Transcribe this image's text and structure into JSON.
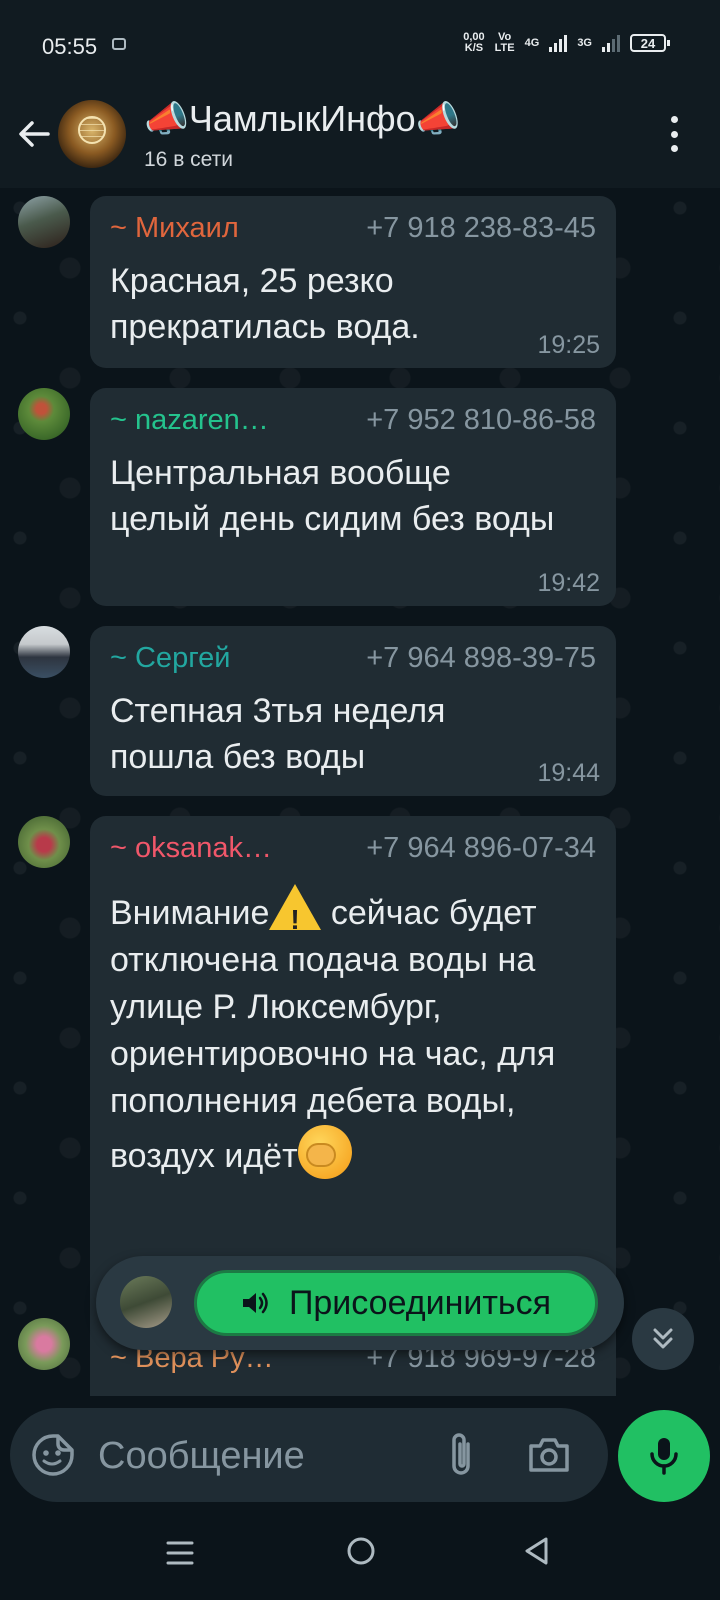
{
  "status_bar": {
    "time": "05:55",
    "speed_value": "0,00",
    "speed_unit": "K/S",
    "volte_top": "Vo",
    "volte_bottom": "LTE",
    "net_1": "4G",
    "net_2": "3G",
    "battery": "24"
  },
  "header": {
    "group_name": "📣ЧамлыкИнфо📣",
    "online_status": "16 в сети"
  },
  "messages": [
    {
      "sender": "~ Михаил",
      "sender_color": "#e0663d",
      "phone": "+7 918 238-83-45",
      "text": "Красная, 25 резко прекратилась вода.",
      "time": "19:25"
    },
    {
      "sender": "~ nazaren…",
      "sender_color": "#24c38d",
      "phone": "+7 952 810-86-58",
      "text": "Центральная вообще целый день сидим без воды",
      "time": "19:42"
    },
    {
      "sender": "~ Сергей",
      "sender_color": "#22a7a0",
      "phone": "+7 964 898-39-75",
      "text": "Степная 3тья неделя пошла без воды",
      "time": "19:44"
    },
    {
      "sender": "~ oksanak…",
      "sender_color": "#f0576a",
      "phone": "+7 964 896-07-34",
      "text_part1": "Внимание",
      "text_part2": " сейчас будет отключена подача воды на улице Р. Люксембург, ориентировочно на час, для пополнения дебета воды, воздух идёт"
    },
    {
      "sender": "~ Вера Ру…",
      "sender_color": "#e0915b",
      "phone": "+7 918 969-97-28"
    }
  ],
  "voice_chat": {
    "join_label": "Присоединиться"
  },
  "input": {
    "placeholder": "Сообщение"
  },
  "colors": {
    "accent": "#21c063",
    "bubble": "#202c33",
    "background": "#0b141a"
  }
}
